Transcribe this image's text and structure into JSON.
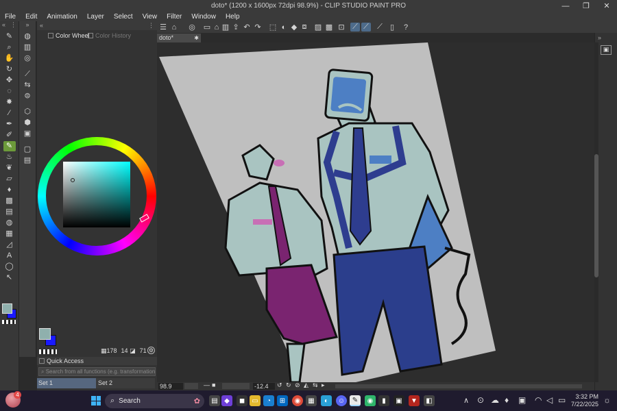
{
  "window": {
    "title": "doto* (1200 x 1600px 72dpi 98.9%) - CLIP STUDIO PAINT PRO",
    "minimize": "—",
    "maximize": "❐",
    "close": "✕"
  },
  "menu": [
    "File",
    "Edit",
    "Animation",
    "Layer",
    "Select",
    "View",
    "Filter",
    "Window",
    "Help"
  ],
  "tools": [
    {
      "icon": "pen-icon",
      "glyph": "✎"
    },
    {
      "icon": "zoom-icon",
      "glyph": "⌕"
    },
    {
      "icon": "hand-icon",
      "glyph": "✋"
    },
    {
      "icon": "rotate-icon",
      "glyph": "↻"
    },
    {
      "icon": "move-icon",
      "glyph": "✥"
    },
    {
      "icon": "lasso-icon",
      "glyph": "◌"
    },
    {
      "icon": "auto-select-icon",
      "glyph": "✸"
    },
    {
      "icon": "eyedropper-icon",
      "glyph": "⁄"
    },
    {
      "icon": "pen-tool-icon",
      "glyph": "✒"
    },
    {
      "icon": "pencil-icon",
      "glyph": "✐"
    },
    {
      "icon": "brush-icon",
      "glyph": "✎"
    },
    {
      "icon": "airbrush-icon",
      "glyph": "♨"
    },
    {
      "icon": "decoration-icon",
      "glyph": "❦"
    },
    {
      "icon": "eraser-icon",
      "glyph": "▱"
    },
    {
      "icon": "blend-icon",
      "glyph": "♦"
    },
    {
      "icon": "fill-icon",
      "glyph": "▩"
    },
    {
      "icon": "gradient-icon",
      "glyph": "▤"
    },
    {
      "icon": "figure-icon",
      "glyph": "◍"
    },
    {
      "icon": "frame-icon",
      "glyph": "▦"
    },
    {
      "icon": "ruler-icon",
      "glyph": "◿"
    },
    {
      "icon": "text-icon",
      "glyph": "A"
    },
    {
      "icon": "balloon-icon",
      "glyph": "◯"
    },
    {
      "icon": "correct-line-icon",
      "glyph": "↖"
    }
  ],
  "color_panel": {
    "tabs": [
      "Color Wheel",
      "Color History"
    ],
    "main_color": "#8fb0ad",
    "sub_color": "#1a1aff"
  },
  "size_readouts": {
    "a": "178",
    "b": "14",
    "c": "71"
  },
  "quick_access": {
    "title": "Quick Access",
    "search_placeholder": "Search from all functions (e.g. transformation, all bo",
    "sets": [
      "Set 1",
      "Set 2"
    ]
  },
  "document": {
    "tab": "doto*"
  },
  "status": {
    "zoom": "98.9",
    "angle": "-12.4"
  },
  "taskbar": {
    "search_label": "Search",
    "time": "3:32 PM",
    "date": "7/22/2025",
    "notification_count": "4"
  },
  "colors": {
    "accent": "#6c9a3a",
    "canvas_paper": "#bfbfbf",
    "character_light": "#a9c4c1",
    "tie_blue": "#2e3d8f",
    "screen_blue": "#4d7fc4",
    "skirt_purple": "#7a2470",
    "pants_blue": "#2b3e8c"
  }
}
